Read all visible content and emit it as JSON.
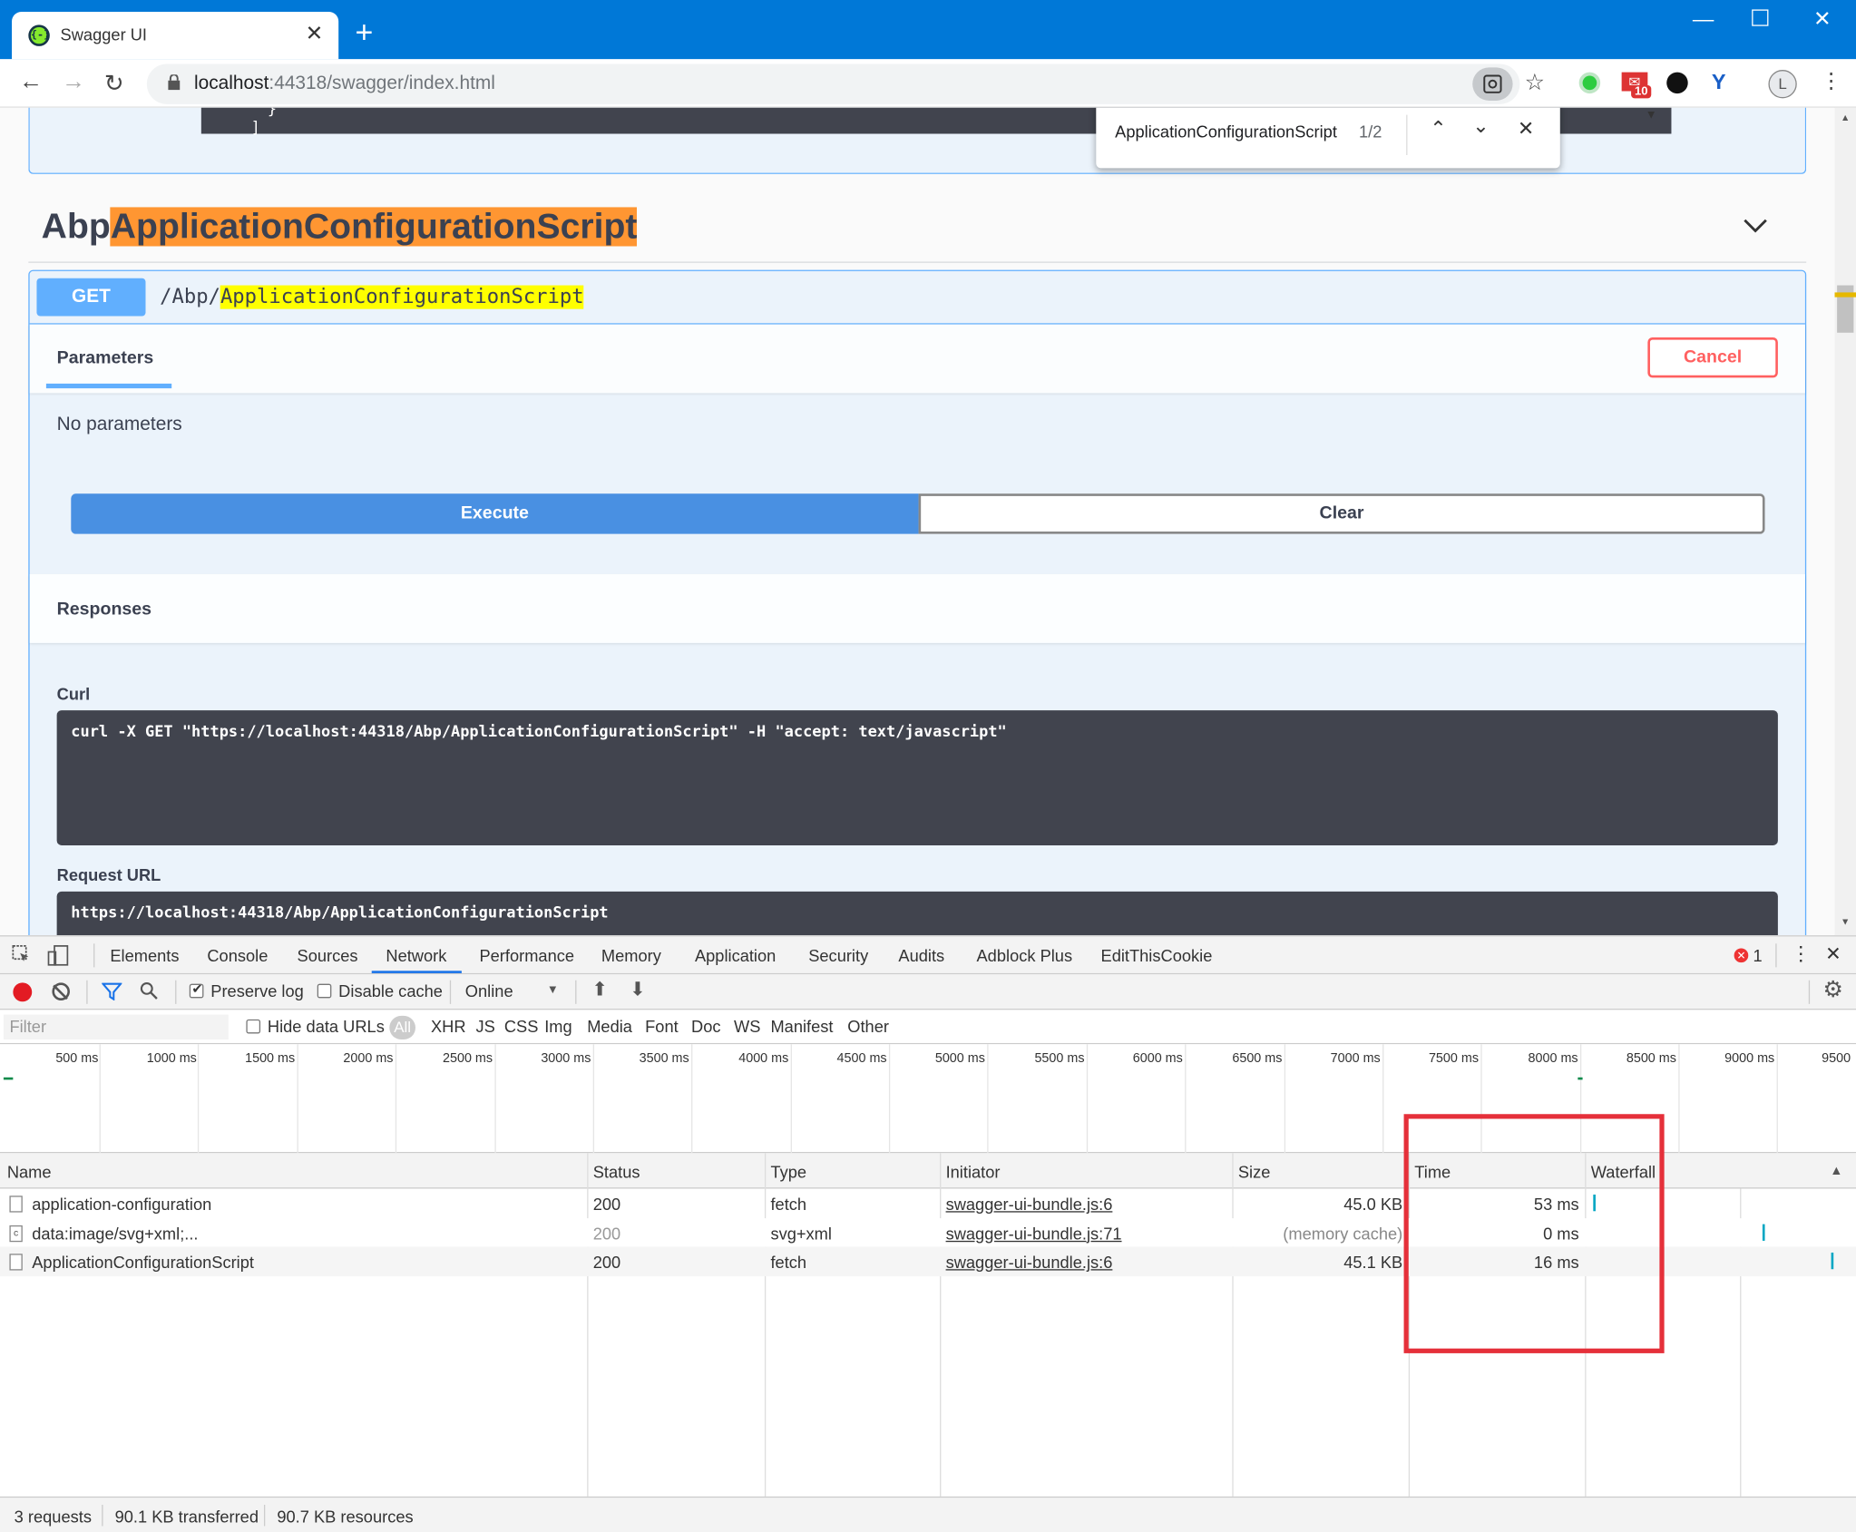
{
  "browser": {
    "tab_title": "Swagger UI",
    "tab_icon": "{-}",
    "new_tab": "+",
    "url_host": "localhost",
    "url_rest": ":44318/swagger/index.html",
    "ext_badge": "10",
    "profile_initial": "L"
  },
  "find": {
    "query": "ApplicationConfigurationScript",
    "count": "1/2"
  },
  "swagger": {
    "code_fragment_1": "}",
    "code_fragment_2": "]",
    "tag_prefix": "Abp",
    "tag_highlight": "ApplicationConfigurationScript",
    "method": "GET",
    "path_prefix": "/Abp/",
    "path_highlight": "ApplicationConfigurationScript",
    "parameters_tab": "Parameters",
    "cancel_label": "Cancel",
    "no_parameters": "No parameters",
    "execute_label": "Execute",
    "clear_label": "Clear",
    "responses_label": "Responses",
    "curl_label": "Curl",
    "curl_command": "curl -X GET \"https://localhost:44318/Abp/ApplicationConfigurationScript\" -H \"accept: text/javascript\"",
    "request_url_label": "Request URL",
    "request_url": "https://localhost:44318/Abp/ApplicationConfigurationScript"
  },
  "devtools": {
    "tabs": [
      "Elements",
      "Console",
      "Sources",
      "Network",
      "Performance",
      "Memory",
      "Application",
      "Security",
      "Audits",
      "Adblock Plus",
      "EditThisCookie"
    ],
    "active_tab": "Network",
    "error_count": "1",
    "preserve_log": "Preserve log",
    "disable_cache": "Disable cache",
    "throttle": "Online",
    "filter_placeholder": "Filter",
    "hide_data_urls": "Hide data URLs",
    "filter_types": [
      "All",
      "XHR",
      "JS",
      "CSS",
      "Img",
      "Media",
      "Font",
      "Doc",
      "WS",
      "Manifest",
      "Other"
    ],
    "timeline_ticks": [
      "500 ms",
      "1000 ms",
      "1500 ms",
      "2000 ms",
      "2500 ms",
      "3000 ms",
      "3500 ms",
      "4000 ms",
      "4500 ms",
      "5000 ms",
      "5500 ms",
      "6000 ms",
      "6500 ms",
      "7000 ms",
      "7500 ms",
      "8000 ms",
      "8500 ms",
      "9000 ms",
      "9500"
    ],
    "columns": [
      "Name",
      "Status",
      "Type",
      "Initiator",
      "Size",
      "Time",
      "Waterfall"
    ],
    "rows": [
      {
        "name": "application-configuration",
        "status": "200",
        "type": "fetch",
        "initiator": "swagger-ui-bundle.js:6",
        "size": "45.0 KB",
        "time": "53 ms"
      },
      {
        "name": "data:image/svg+xml;...",
        "status": "200",
        "type": "svg+xml",
        "initiator": "swagger-ui-bundle.js:71",
        "size": "(memory cache)",
        "time": "0 ms"
      },
      {
        "name": "ApplicationConfigurationScript",
        "status": "200",
        "type": "fetch",
        "initiator": "swagger-ui-bundle.js:6",
        "size": "45.1 KB",
        "time": "16 ms"
      }
    ],
    "summary": {
      "requests": "3 requests",
      "transferred": "90.1 KB transferred",
      "resources": "90.7 KB resources"
    }
  },
  "colors": {
    "chrome_blue": "#0078d7",
    "swagger_get": "#61affe",
    "execute_blue": "#4990e2",
    "cancel_red": "#ff6060",
    "find_orange": "#ff9632",
    "find_yellow": "#ffff00",
    "annotation_red": "#e5303a"
  }
}
